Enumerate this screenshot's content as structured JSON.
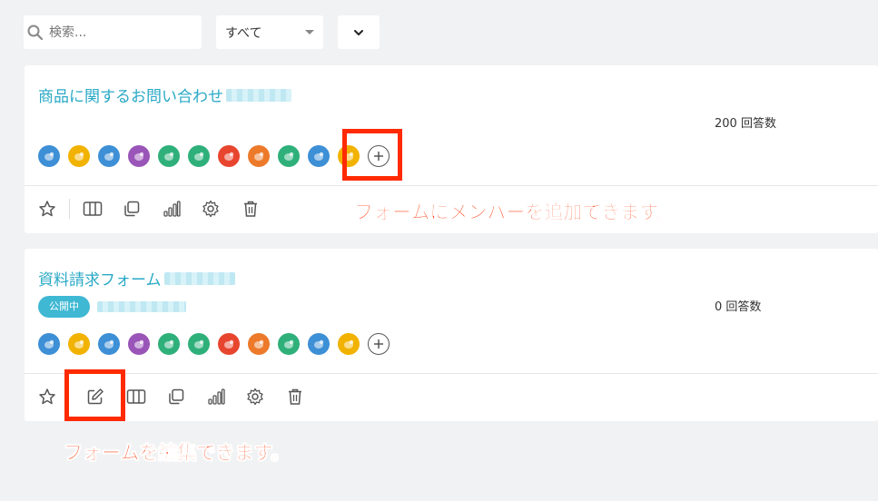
{
  "search": {
    "placeholder": "検索..."
  },
  "filter": {
    "selected": "すべて"
  },
  "forms": [
    {
      "title": "商品に関するお問い合わせ",
      "answers": "200 回答数",
      "status": ""
    },
    {
      "title": "資料請求フォーム",
      "answers": "0 回答数",
      "status": "公開中"
    }
  ],
  "avatar_colors": [
    "#3d8fd6",
    "#f1b200",
    "#3d8fd6",
    "#9a55b8",
    "#2fb07a",
    "#2fb07a",
    "#e8452f",
    "#ec7a2a",
    "#2fb07a",
    "#3d8fd6",
    "#f1b200"
  ],
  "annotations": {
    "add_member": "フォームにメンバーを追加できます。",
    "edit_form": "フォームを編集できます。"
  },
  "accent_color": "#29a9c6",
  "highlight_color": "#ff2a00"
}
